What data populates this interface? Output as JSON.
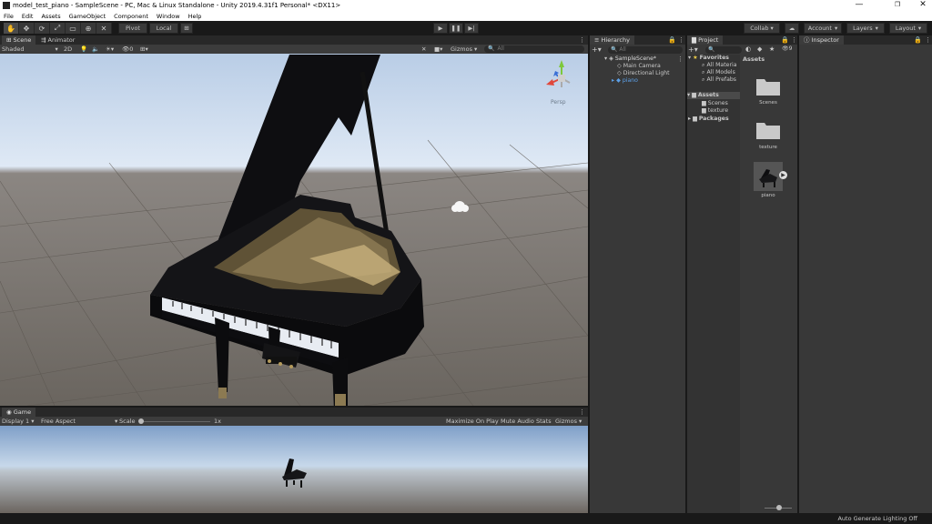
{
  "window": {
    "title": "model_test_piano - SampleScene - PC, Mac & Linux Standalone - Unity 2019.4.31f1 Personal* <DX11>",
    "controls": [
      "—",
      "❐",
      "✕"
    ]
  },
  "menu": [
    "File",
    "Edit",
    "Assets",
    "GameObject",
    "Component",
    "Window",
    "Help"
  ],
  "toolbar": {
    "pivot_label": "Pivot",
    "local_label": "Local",
    "collab_label": "Collab ▾",
    "account_label": "Account",
    "layers_label": "Layers",
    "layout_label": "Layout"
  },
  "scene": {
    "tabs": [
      "Scene",
      "Animator"
    ],
    "shading_mode": "Shaded",
    "mode_2d": "2D",
    "gizmos_label": "Gizmos",
    "search_placeholder": "All",
    "hidden_count": "0",
    "persp_label": "Persp"
  },
  "game": {
    "tab": "Game",
    "display": "Display 1",
    "aspect": "Free Aspect",
    "scale_label": "Scale",
    "scale_value": "1x",
    "maximize": "Maximize On Play",
    "mute": "Mute Audio",
    "stats": "Stats",
    "gizmos": "Gizmos"
  },
  "hierarchy": {
    "tab": "Hierarchy",
    "search_placeholder": "All",
    "scene_name": "SampleScene*",
    "items": [
      "Main Camera",
      "Directional Light",
      "piano"
    ]
  },
  "project": {
    "tab": "Project",
    "favorites_label": "Favorites",
    "favorites": [
      "All Materia",
      "All Models",
      "All Prefabs"
    ],
    "assets_label": "Assets",
    "asset_folders": [
      "Scenes",
      "texture"
    ],
    "packages_label": "Packages",
    "assets_header": "Assets",
    "grid_items": [
      "Scenes",
      "texture",
      "piano"
    ],
    "hidden_count": "9"
  },
  "inspector": {
    "tab": "Inspector"
  },
  "status": {
    "text": "Auto Generate Lighting Off"
  }
}
